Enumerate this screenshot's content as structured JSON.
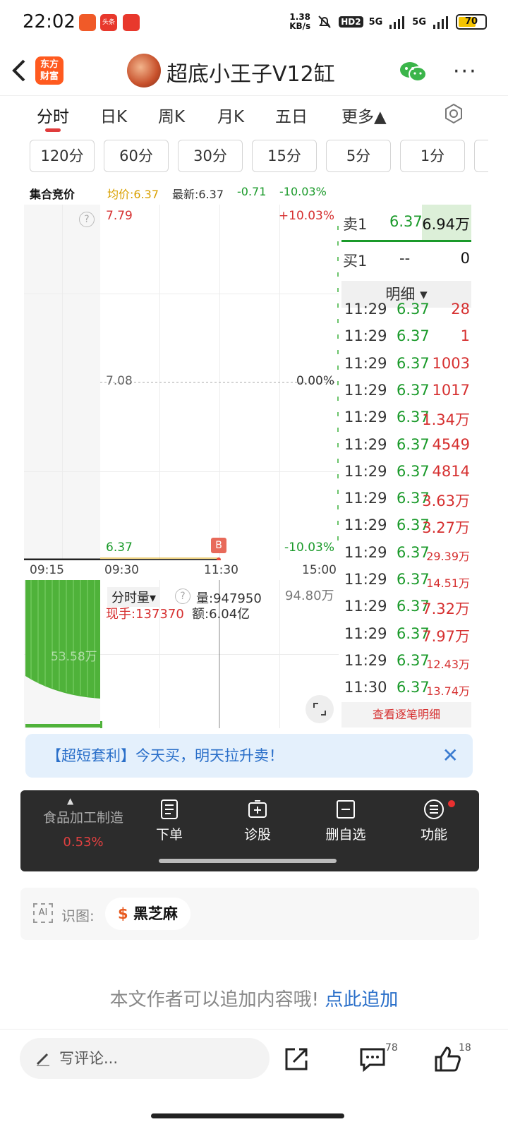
{
  "status_bar": {
    "time": "22:02",
    "app_icons": [
      "app-icon-red",
      "toutiao-icon",
      "lottery-icon"
    ],
    "toutiao_text": "头条",
    "net_speed_value": "1.38",
    "net_speed_unit": "KB/s",
    "hd": "HD2",
    "signal1": "5G",
    "signal2": "5G",
    "battery": "70",
    "battery_level": 0.7
  },
  "header": {
    "back_icon": "chevron-left-icon",
    "logo_text_1": "东方",
    "logo_text_2": "财富",
    "title": "超底小王子V12缸",
    "share_icon": "wechat-icon",
    "more_icon": "more-dots-icon",
    "more_text": "···"
  },
  "tabs": {
    "items": [
      "分时",
      "日K",
      "周K",
      "月K",
      "五日",
      "更多▲"
    ],
    "active": "分时",
    "settings_icon": "gear-icon"
  },
  "intervals": [
    "120分",
    "60分",
    "30分",
    "15分",
    "5分",
    "1分"
  ],
  "info_row": {
    "label": "集合竞价",
    "avg": "均价:6.37",
    "latest": "最新:6.37",
    "change": "-0.71",
    "change_pct": "-10.03%"
  },
  "chart": {
    "price_high": "7.79",
    "price_mid": "7.08",
    "price_low": "6.37",
    "pct_high": "+10.03%",
    "pct_mid": "0.00%",
    "pct_low": "-10.03%",
    "help_icon": "help-icon",
    "question_mark": "?",
    "b_marker": "B",
    "times": [
      "09:15",
      "09:30",
      "11:30",
      "15:00"
    ],
    "volume_selector": "分时量▾",
    "volume_total": "量:947950",
    "current_hand": "现手:137370",
    "amount": "额:6.04亿",
    "vol_max": "94.80万",
    "vol_pre_label": "53.58万",
    "expand_icon": "expand-icon"
  },
  "order_book": {
    "sell1_label": "卖1",
    "sell1_price": "6.37",
    "sell1_vol": "6.94万",
    "buy1_label": "买1",
    "buy1_price": "--",
    "buy1_vol": "0",
    "detail_header": "明细 ▾",
    "trades": [
      {
        "t": "11:29",
        "p": "6.37",
        "v": "28"
      },
      {
        "t": "11:29",
        "p": "6.37",
        "v": "1"
      },
      {
        "t": "11:29",
        "p": "6.37",
        "v": "1003"
      },
      {
        "t": "11:29",
        "p": "6.37",
        "v": "1017"
      },
      {
        "t": "11:29",
        "p": "6.37",
        "v": "1.34万"
      },
      {
        "t": "11:29",
        "p": "6.37",
        "v": "4549"
      },
      {
        "t": "11:29",
        "p": "6.37",
        "v": "4814"
      },
      {
        "t": "11:29",
        "p": "6.37",
        "v": "3.63万"
      },
      {
        "t": "11:29",
        "p": "6.37",
        "v": "3.27万"
      },
      {
        "t": "11:29",
        "p": "6.37",
        "v": "29.39万"
      },
      {
        "t": "11:29",
        "p": "6.37",
        "v": "14.51万"
      },
      {
        "t": "11:29",
        "p": "6.37",
        "v": "7.32万"
      },
      {
        "t": "11:29",
        "p": "6.37",
        "v": "7.97万"
      },
      {
        "t": "11:29",
        "p": "6.37",
        "v": "12.43万"
      },
      {
        "t": "11:30",
        "p": "6.37",
        "v": "13.74万"
      }
    ],
    "view_all": "查看逐笔明细"
  },
  "banner": {
    "text": "【超短套利】今天买，明天拉升卖！",
    "close_icon": "close-icon",
    "close_text": "✕"
  },
  "action_bar": {
    "sector": "食品加工制造",
    "sector_change": "0.53%",
    "up_arrow": "▲",
    "items": [
      "下单",
      "诊股",
      "删自选",
      "功能"
    ],
    "icons": [
      "order-icon",
      "diagnose-icon",
      "remove-icon",
      "menu-icon"
    ]
  },
  "ai_strip": {
    "ai_label": "AI",
    "label": "识图:",
    "tag_icon": "$",
    "tag": "黑芝麻"
  },
  "append_note": {
    "text": "本文作者可以追加内容哦!",
    "link": "点此追加"
  },
  "bottom_bar": {
    "pencil_icon": "pencil-icon",
    "comment_placeholder": "写评论...",
    "share_icon": "share-icon",
    "comment_icon": "comment-icon",
    "comment_count": "78",
    "like_icon": "thumbs-up-icon",
    "like_count": "18"
  },
  "colors": {
    "up_red": "#d63030",
    "down_green": "#1a9a2a",
    "avg_orange": "#d9a000",
    "link_blue": "#2a6fc9",
    "brand_orange": "#ff5a1f"
  }
}
